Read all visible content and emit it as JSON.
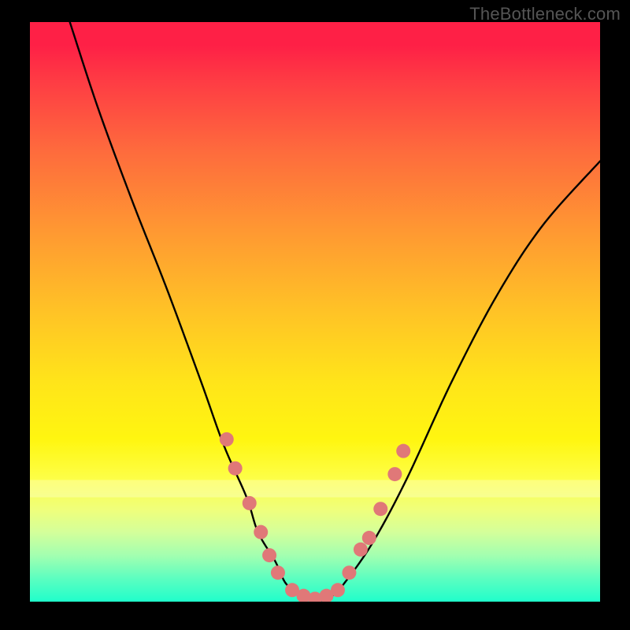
{
  "watermark": "TheBottleneck.com",
  "chart_data": {
    "type": "line",
    "title": "",
    "xlabel": "",
    "ylabel": "",
    "xlim": [
      0,
      100
    ],
    "ylim": [
      0,
      100
    ],
    "grid": false,
    "legend": false,
    "series": [
      {
        "name": "curve",
        "color": "#000000",
        "x": [
          7,
          12,
          18,
          24,
          30,
          34,
          38,
          40,
          43,
          45,
          48,
          50,
          53,
          55,
          60,
          66,
          74,
          82,
          90,
          100
        ],
        "values": [
          100,
          85,
          69,
          54,
          38,
          27,
          18,
          12,
          7,
          3,
          1,
          0,
          1,
          3,
          10,
          21,
          38,
          53,
          65,
          76
        ]
      }
    ],
    "markers": {
      "color": "#e07878",
      "radius_px": 9,
      "points": [
        {
          "x": 34.5,
          "y": 28
        },
        {
          "x": 36,
          "y": 23
        },
        {
          "x": 38.5,
          "y": 17
        },
        {
          "x": 40.5,
          "y": 12
        },
        {
          "x": 42,
          "y": 8
        },
        {
          "x": 43.5,
          "y": 5
        },
        {
          "x": 46,
          "y": 2
        },
        {
          "x": 48,
          "y": 1
        },
        {
          "x": 50,
          "y": 0.5
        },
        {
          "x": 52,
          "y": 1
        },
        {
          "x": 54,
          "y": 2
        },
        {
          "x": 56,
          "y": 5
        },
        {
          "x": 58,
          "y": 9
        },
        {
          "x": 59.5,
          "y": 11
        },
        {
          "x": 61.5,
          "y": 16
        },
        {
          "x": 64,
          "y": 22
        },
        {
          "x": 65.5,
          "y": 26
        }
      ]
    },
    "highlight_band_y": [
      18,
      21
    ]
  }
}
